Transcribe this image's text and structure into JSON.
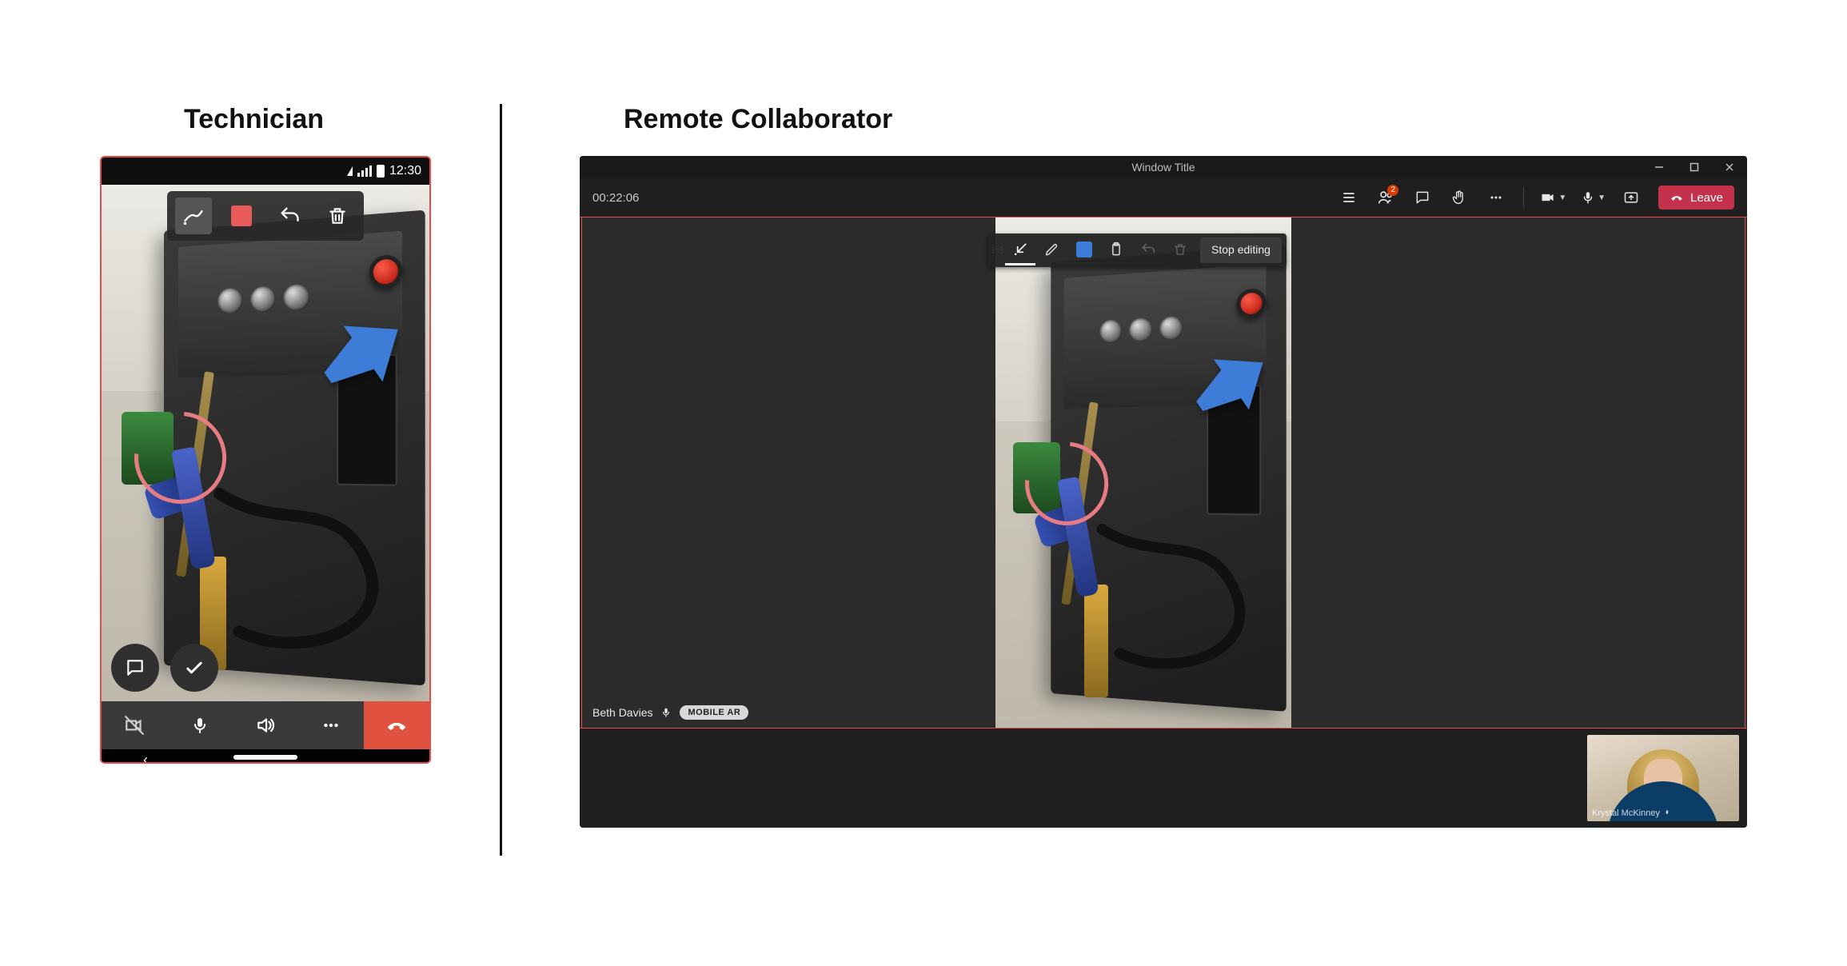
{
  "headings": {
    "technician": "Technician",
    "collaborator": "Remote Collaborator"
  },
  "phone": {
    "status_time": "12:30",
    "toolbar": {
      "pen": "pen",
      "color": "#e95a5a",
      "undo": "undo",
      "delete": "delete"
    },
    "fab": {
      "chat": "chat",
      "confirm": "confirm"
    },
    "callbar": {
      "video_off": "video-off",
      "mic": "mic",
      "speaker": "speaker",
      "more": "more",
      "hangup": "hang-up"
    }
  },
  "desktop": {
    "window_title": "Window Title",
    "timer": "00:22:06",
    "badge_count": "2",
    "leave_label": "Leave",
    "edit_toolbar": {
      "arrow": "arrow",
      "pen": "pen",
      "color": "#3d7dd8",
      "clipboard": "clipboard",
      "undo": "undo",
      "delete": "delete",
      "stop_label": "Stop editing"
    },
    "caption": {
      "name": "Beth Davies",
      "chip": "MOBILE AR"
    },
    "pip_name": "Krystal McKinney"
  },
  "colors": {
    "accent_red": "#c4314b",
    "annotation_pink": "#e77c84",
    "annotation_blue": "#3d7dd8"
  }
}
